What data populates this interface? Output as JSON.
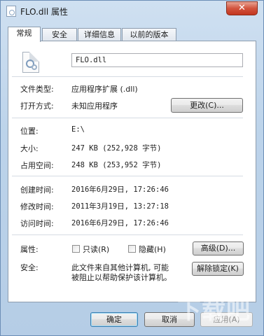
{
  "window": {
    "title": "FLO.dll 属性",
    "close_label": "✕"
  },
  "tabs": [
    {
      "label": "常规",
      "active": true
    },
    {
      "label": "安全",
      "active": false
    },
    {
      "label": "详细信息",
      "active": false
    },
    {
      "label": "以前的版本",
      "active": false
    }
  ],
  "general": {
    "filename": "FLO.dll",
    "file_type_label": "文件类型:",
    "file_type_value": "应用程序扩展 (.dll)",
    "open_with_label": "打开方式:",
    "open_with_value": "未知应用程序",
    "change_button": "更改(C)...",
    "location_label": "位置:",
    "location_value": "E:\\",
    "size_label": "大小:",
    "size_value": "247 KB (252,928 字节)",
    "size_on_disk_label": "占用空间:",
    "size_on_disk_value": "248 KB (253,952 字节)",
    "created_label": "创建时间:",
    "created_value": "2016年6月29日, 17:26:46",
    "modified_label": "修改时间:",
    "modified_value": "2011年3月19日, 13:27:18",
    "accessed_label": "访问时间:",
    "accessed_value": "2016年6月29日, 17:26:46",
    "attributes_label": "属性:",
    "readonly_label": "只读(R)",
    "hidden_label": "隐藏(H)",
    "advanced_button": "高级(D)...",
    "security_label": "安全:",
    "security_text_line1": "此文件来自其他计算机, 可能",
    "security_text_line2": "被阻止以帮助保护该计算机。",
    "unblock_button": "解除锁定(K)"
  },
  "footer": {
    "ok_button": "确定",
    "cancel_button": "取消",
    "apply_button": "应用(A)"
  },
  "watermark": "下载吧"
}
